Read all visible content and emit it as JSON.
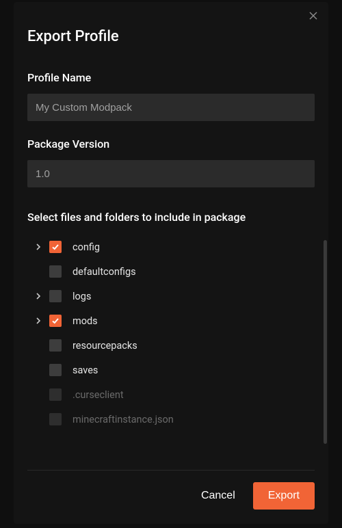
{
  "dialog": {
    "title": "Export Profile"
  },
  "profileName": {
    "label": "Profile Name",
    "value": "My Custom Modpack"
  },
  "packageVersion": {
    "label": "Package Version",
    "value": "1.0"
  },
  "filesSection": {
    "label": "Select files and folders to include in package",
    "items": [
      {
        "name": "config",
        "checked": true,
        "expandable": true,
        "disabled": false
      },
      {
        "name": "defaultconfigs",
        "checked": false,
        "expandable": false,
        "disabled": false
      },
      {
        "name": "logs",
        "checked": false,
        "expandable": true,
        "disabled": false
      },
      {
        "name": "mods",
        "checked": true,
        "expandable": true,
        "disabled": false
      },
      {
        "name": "resourcepacks",
        "checked": false,
        "expandable": false,
        "disabled": false
      },
      {
        "name": "saves",
        "checked": false,
        "expandable": false,
        "disabled": false
      },
      {
        "name": ".curseclient",
        "checked": false,
        "expandable": false,
        "disabled": true
      },
      {
        "name": "minecraftinstance.json",
        "checked": false,
        "expandable": false,
        "disabled": true
      }
    ]
  },
  "footer": {
    "cancel": "Cancel",
    "export": "Export"
  },
  "colors": {
    "accent": "#f16436",
    "background": "#141414",
    "inputBg": "#2b2b2b"
  }
}
